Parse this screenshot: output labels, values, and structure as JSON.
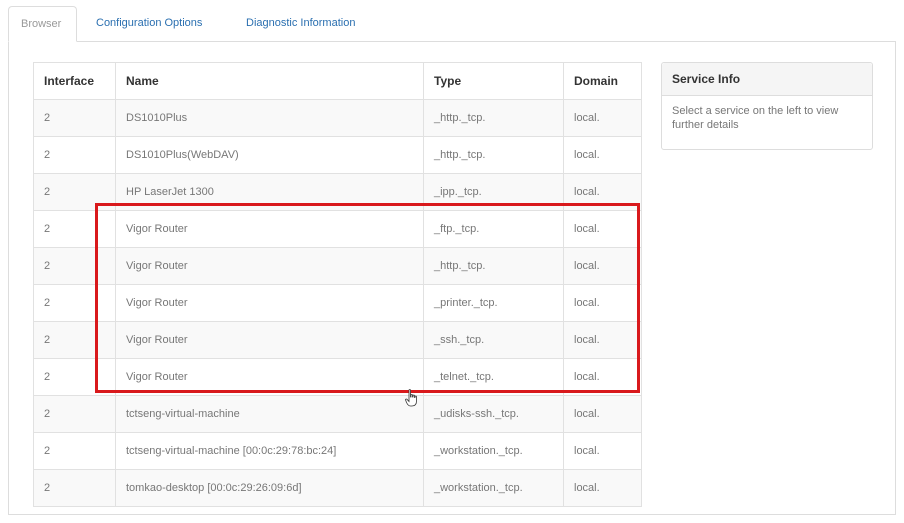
{
  "tabs": [
    {
      "label": "Browser",
      "active": true
    },
    {
      "label": "Configuration Options",
      "active": false
    },
    {
      "label": "Diagnostic Information",
      "active": false
    }
  ],
  "table": {
    "headers": [
      "Interface",
      "Name",
      "Type",
      "Domain"
    ],
    "rows": [
      [
        "2",
        "DS1010Plus",
        "_http._tcp.",
        "local."
      ],
      [
        "2",
        "DS1010Plus(WebDAV)",
        "_http._tcp.",
        "local."
      ],
      [
        "2",
        "HP LaserJet 1300",
        "_ipp._tcp.",
        "local."
      ],
      [
        "2",
        "Vigor Router",
        "_ftp._tcp.",
        "local."
      ],
      [
        "2",
        "Vigor Router",
        "_http._tcp.",
        "local."
      ],
      [
        "2",
        "Vigor Router",
        "_printer._tcp.",
        "local."
      ],
      [
        "2",
        "Vigor Router",
        "_ssh._tcp.",
        "local."
      ],
      [
        "2",
        "Vigor Router",
        "_telnet._tcp.",
        "local."
      ],
      [
        "2",
        "tctseng-virtual-machine",
        "_udisks-ssh._tcp.",
        "local."
      ],
      [
        "2",
        "tctseng-virtual-machine [00:0c:29:78:bc:24]",
        "_workstation._tcp.",
        "local."
      ],
      [
        "2",
        "tomkao-desktop [00:0c:29:26:09:6d]",
        "_workstation._tcp.",
        "local."
      ]
    ]
  },
  "service_info": {
    "title": "Service Info",
    "body": "Select a service on the left to view further details"
  },
  "colors": {
    "link": "#2a6fb0",
    "highlight": "#d9191c"
  },
  "icons": {
    "cursor": "hand-pointer-icon"
  }
}
